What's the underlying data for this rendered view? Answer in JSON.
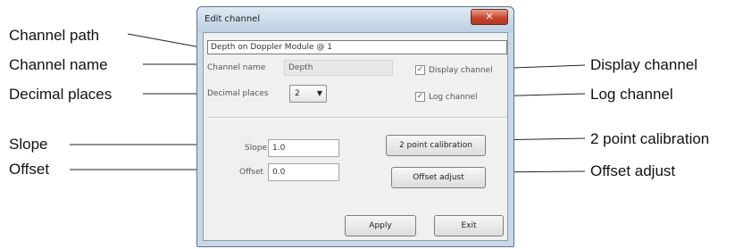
{
  "dialog": {
    "title": "Edit channel",
    "close_glyph": "✕",
    "channel_path": "Depth on Doppler Module @ 1",
    "channel_name_label": "Channel name",
    "channel_name_value": "Depth",
    "decimal_places_label": "Decimal places",
    "decimal_places_value": "2",
    "decimal_places_arrow": "▼",
    "display_channel_label": "Display channel",
    "display_channel_checked": true,
    "log_channel_label": "Log channel",
    "log_channel_checked": true,
    "check_glyph": "✓",
    "slope_label": "Slope",
    "slope_value": "1.0",
    "offset_label": "Offset",
    "offset_value": "0.0",
    "two_point_button": "2 point calibration",
    "offset_adjust_button": "Offset adjust",
    "apply_button": "Apply",
    "exit_button": "Exit"
  },
  "callouts": {
    "channel_path": "Channel path",
    "channel_name": "Channel name",
    "decimal_places": "Decimal places",
    "slope": "Slope",
    "offset": "Offset",
    "display_channel": "Display channel",
    "log_channel": "Log channel",
    "two_point_calibration": "2 point calibration",
    "offset_adjust": "Offset adjust"
  }
}
